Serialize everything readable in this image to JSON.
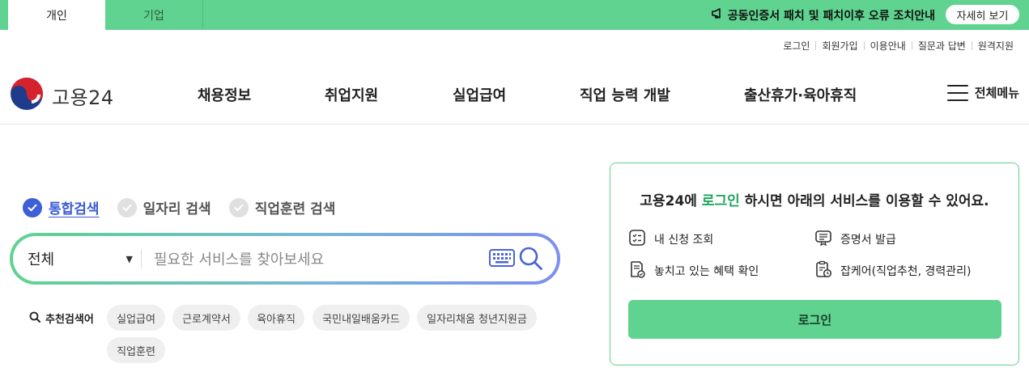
{
  "topbar": {
    "tabs": [
      {
        "label": "개인",
        "active": true
      },
      {
        "label": "기업",
        "active": false
      }
    ],
    "notice": "공동인증서 패치 및 패치이후 오류 조치안내",
    "notice_button": "자세히 보기"
  },
  "utility_links": [
    "로그인",
    "회원가입",
    "이용안내",
    "질문과 답변",
    "원격지원"
  ],
  "header": {
    "logo_text": "고용24",
    "nav": [
      "채용정보",
      "취업지원",
      "실업급여",
      "직업 능력 개발",
      "출산휴가·육아휴직"
    ],
    "all_menu": "전체메뉴"
  },
  "search": {
    "tabs": [
      {
        "label": "통합검색",
        "active": true
      },
      {
        "label": "일자리 검색",
        "active": false
      },
      {
        "label": "직업훈련 검색",
        "active": false
      }
    ],
    "category": "전체",
    "placeholder": "필요한 서비스를 찾아보세요",
    "recommended_title": "추천검색어",
    "recommended": [
      "실업급여",
      "근로계약서",
      "육아휴직",
      "국민내일배움카드",
      "일자리채움 청년지원금",
      "직업훈련"
    ]
  },
  "login_panel": {
    "title_prefix": "고용24에 ",
    "title_accent": "로그인",
    "title_suffix": " 하시면 아래의 서비스를 이용할 수 있어요.",
    "services": [
      "내 신청 조회",
      "증명서 발급",
      "놓치고 있는 혜택 확인",
      "잡케어(직업추천, 경력관리)"
    ],
    "login_button": "로그인"
  },
  "colors": {
    "brand_green": "#5fd38f",
    "accent_blue": "#3f5fd8"
  }
}
